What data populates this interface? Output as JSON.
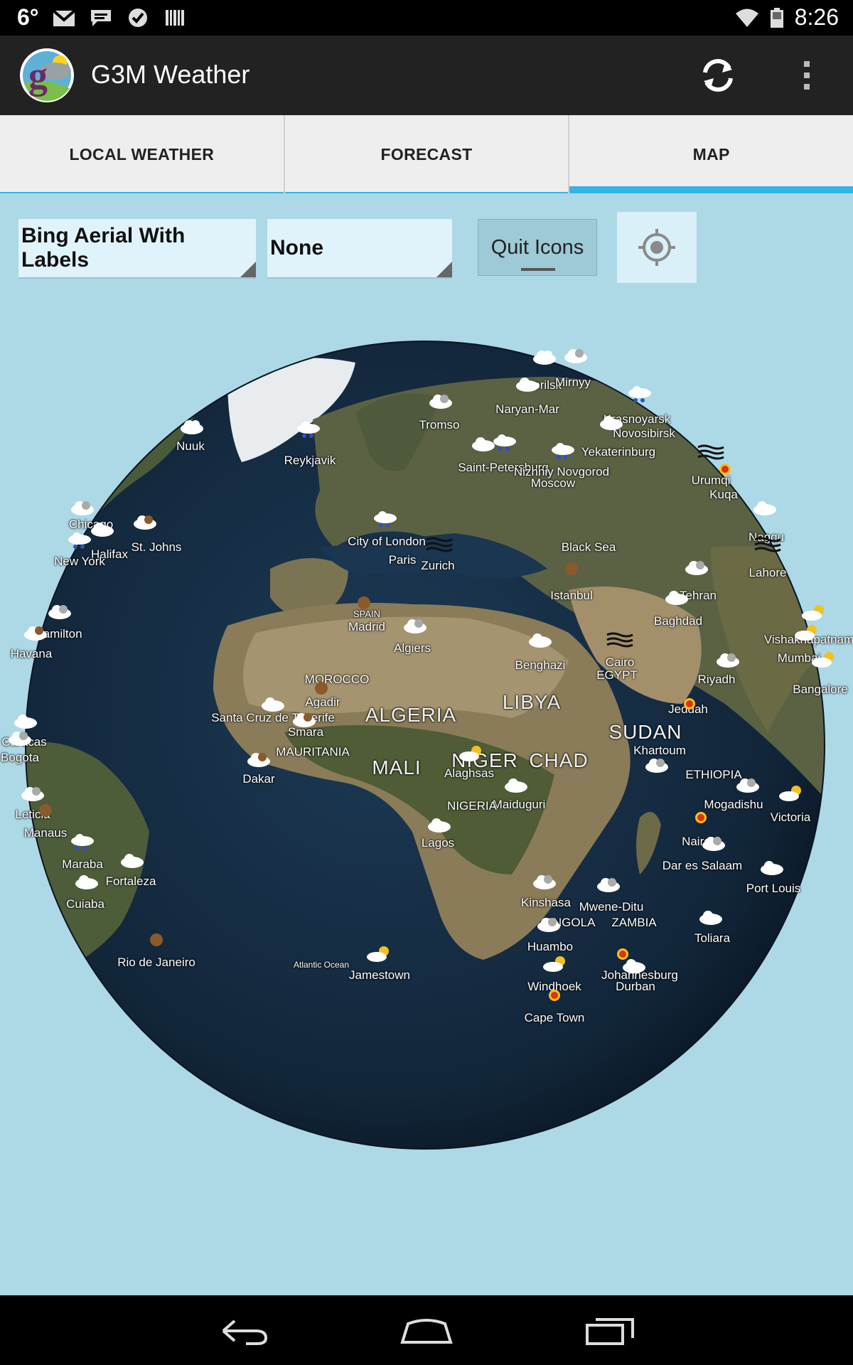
{
  "status_bar": {
    "temperature": "6°",
    "time": "8:26"
  },
  "app": {
    "title": "G3M Weather"
  },
  "tabs": [
    {
      "label": "LOCAL WEATHER",
      "active": false
    },
    {
      "label": "FORECAST",
      "active": false
    },
    {
      "label": "MAP",
      "active": true
    }
  ],
  "controls": {
    "layer_select": "Bing Aerial With Labels",
    "overlay_select": "None",
    "quit_icons_label": "Quit Icons"
  },
  "map": {
    "labels": [
      "Nuuk",
      "Reykjavik",
      "Tromso",
      "Naryan-Mar",
      "Norilsk",
      "Mirnyy",
      "Krasnoyarsk",
      "Novosibirsk",
      "Yekaterinburg",
      "Saint-Petersburg",
      "Nizhniy Novgorod",
      "Moscow",
      "Urumqi",
      "Kuqa",
      "Chicago",
      "Halifax",
      "St. Johns",
      "New York",
      "City of London",
      "Paris",
      "Zurich",
      "Black Sea",
      "Istanbul",
      "Nagqu",
      "Lahore",
      "Tehran",
      "Baghdad",
      "Madrid",
      "Algiers",
      "Hamilton",
      "Havana",
      "Benghazi",
      "Cairo",
      "EGYPT",
      "Vishakhapatnam",
      "Mumbai",
      "Bangalore",
      "Riyadh",
      "Jeddah",
      "ALGERIA",
      "LIBYA",
      "MOROCCO",
      "Agadir",
      "Santa Cruz de Tenerife",
      "Smara",
      "Caracas",
      "Bogota",
      "MAURITANIA",
      "MALI",
      "NIGER",
      "CHAD",
      "SUDAN",
      "Khartoum",
      "ETHIOPIA",
      "Dakar",
      "Alaghsas",
      "Maiduguri",
      "NIGERIA",
      "Mogadishu",
      "Victoria",
      "Leticia",
      "Manaus",
      "Lagos",
      "Nairobi",
      "Dar es Salaam",
      "Maraba",
      "Fortaleza",
      "Cuiaba",
      "Kinshasa",
      "Mwene-Ditu",
      "Port Louis",
      "Toliara",
      "Huambo",
      "Rio de Janeiro",
      "Jamestown",
      "Windhoek",
      "Johannesburg",
      "Durban",
      "Cape Town",
      "ANGOLA",
      "ZAMBIA",
      "Atlantic Ocean",
      "SPAIN"
    ]
  },
  "icons": {
    "logo": "g3m-logo-icon",
    "refresh": "refresh-icon",
    "overflow": "overflow-menu-icon",
    "locate": "my-location-icon",
    "back": "back-icon",
    "home": "home-icon",
    "recents": "recents-icon"
  },
  "colors": {
    "accent": "#33b5e5",
    "background": "#add8e6",
    "actionbar": "#222222"
  }
}
